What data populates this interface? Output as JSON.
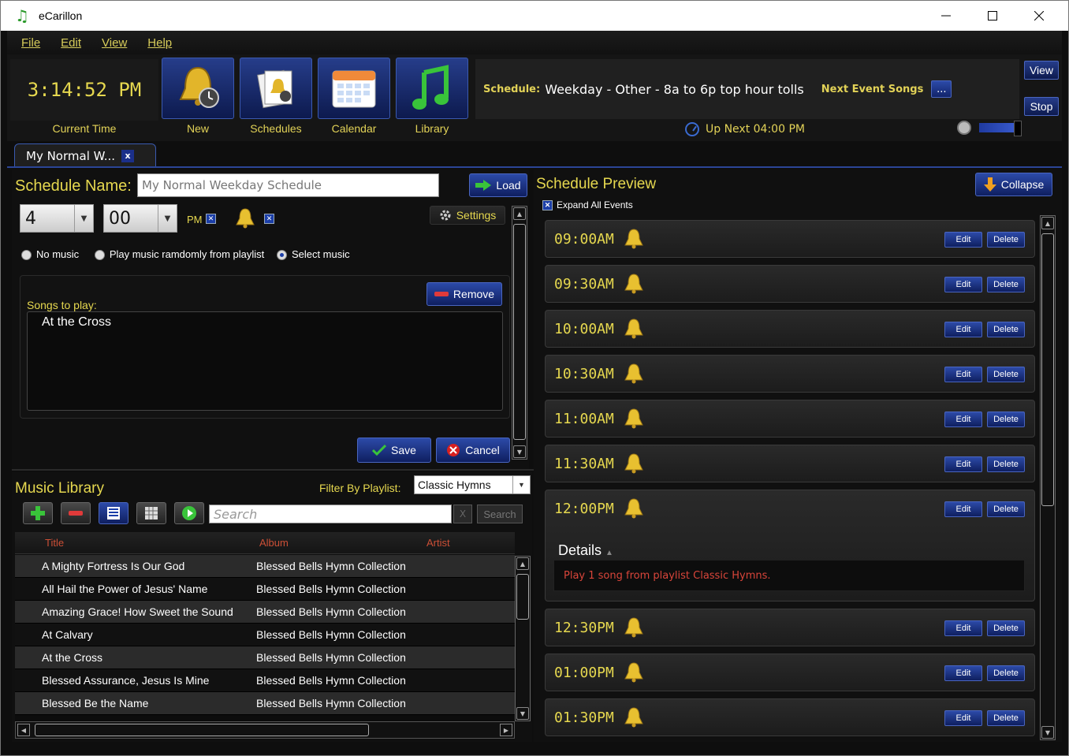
{
  "window": {
    "title": "eCarillon",
    "minimize": "—",
    "maximize": "☐",
    "close": "✕"
  },
  "menu": [
    "File",
    "Edit",
    "View",
    "Help"
  ],
  "toolbar": {
    "clock": "3:14:52 PM",
    "clock_label": "Current Time",
    "buttons": [
      {
        "label": "New",
        "icon": "bell-clock-icon"
      },
      {
        "label": "Schedules",
        "icon": "schedules-icon"
      },
      {
        "label": "Calendar",
        "icon": "calendar-icon"
      },
      {
        "label": "Library",
        "icon": "music-note-icon"
      }
    ],
    "schedule_key": "Schedule:",
    "schedule_value": "Weekday - Other - 8a to 6p top hour tolls",
    "next_event_songs": "Next Event Songs",
    "dots": "...",
    "view": "View",
    "stop": "Stop",
    "up_next": "Up Next 04:00 PM"
  },
  "tab": {
    "label": "My Normal W...",
    "close": "x"
  },
  "editor": {
    "name_label": "Schedule Name:",
    "name_value": "My Normal Weekday Schedule",
    "load": "Load",
    "hour": "4",
    "minute": "00",
    "ampm": "PM",
    "settings": "Settings",
    "radio": [
      "No music",
      "Play music ramdomly from playlist",
      "Select music"
    ],
    "radio_selected": 2,
    "remove": "Remove",
    "songs_label": "Songs to play:",
    "songs": [
      "At the Cross"
    ],
    "save": "Save",
    "cancel": "Cancel"
  },
  "library": {
    "title": "Music Library",
    "filter_label": "Filter By Playlist:",
    "filter_value": "Classic Hymns",
    "search_placeholder": "Search",
    "search_clear": "X",
    "search_button": "Search",
    "columns": [
      "Title",
      "Album",
      "Artist"
    ],
    "rows": [
      [
        "A Mighty Fortress Is Our God",
        "Blessed Bells Hymn Collection",
        ""
      ],
      [
        "All Hail the Power of Jesus' Name",
        "Blessed Bells Hymn Collection",
        ""
      ],
      [
        "Amazing Grace! How Sweet the Sound",
        "Blessed Bells Hymn Collection",
        ""
      ],
      [
        "At Calvary",
        "Blessed Bells Hymn Collection",
        ""
      ],
      [
        "At the Cross",
        "Blessed Bells Hymn Collection",
        ""
      ],
      [
        "Blessed Assurance, Jesus Is Mine",
        "Blessed Bells Hymn Collection",
        ""
      ],
      [
        "Blessed Be the Name",
        "Blessed Bells Hymn Collection",
        ""
      ]
    ]
  },
  "preview": {
    "title": "Schedule Preview",
    "collapse": "Collapse",
    "expand_all": "Expand All Events",
    "edit": "Edit",
    "delete": "Delete",
    "details_title": "Details",
    "details_text": "Play 1 song from playlist Classic Hymns.",
    "events": [
      "09:00AM",
      "09:30AM",
      "10:00AM",
      "10:30AM",
      "11:00AM",
      "11:30AM",
      "12:00PM",
      "12:30PM",
      "01:00PM",
      "01:30PM"
    ],
    "expanded_index": 6
  },
  "colors": {
    "accent_yellow": "#e6d84f",
    "accent_blue": "#1b3ea8",
    "detail_red": "#d9453a",
    "column_header": "#cc4f36"
  }
}
